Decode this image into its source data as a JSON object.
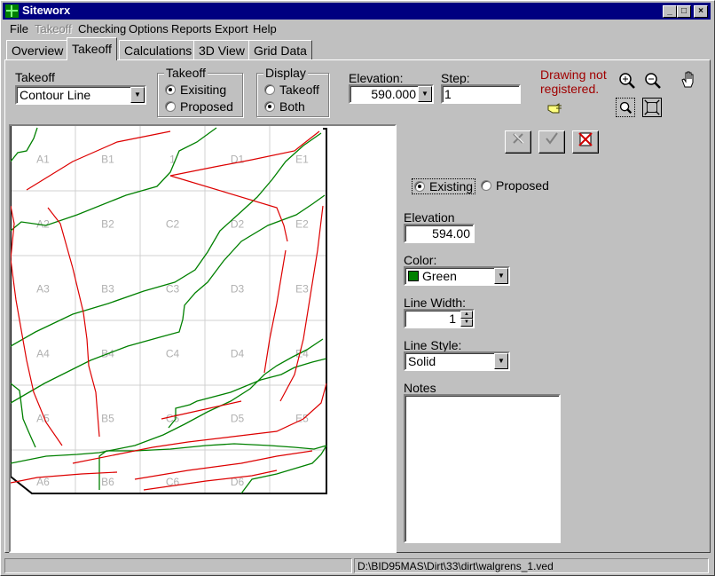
{
  "window": {
    "title": "Siteworx"
  },
  "menu": [
    "File",
    "Takeoff",
    "Checking",
    "Options",
    "Reports",
    "Export",
    "Help"
  ],
  "tabs": [
    "Overview",
    "Takeoff",
    "Calculations",
    "3D View",
    "Grid Data"
  ],
  "toolbar": {
    "takeoff_label": "Takeoff",
    "takeoff_value": "Contour Line",
    "takeoff_group_label": "Takeoff",
    "takeoff_opt_existing": "Exisiting",
    "takeoff_opt_proposed": "Proposed",
    "display_group_label": "Display",
    "display_opt_takeoff": "Takeoff",
    "display_opt_both": "Both",
    "elevation_label": "Elevation:",
    "elevation_value": "590.000",
    "step_label": "Step:",
    "step_value": "1",
    "warning": "Drawing not registered."
  },
  "grid": {
    "labels": [
      [
        "A1",
        "B1",
        "1",
        "D1",
        "E1"
      ],
      [
        "A2",
        "B2",
        "C2",
        "D2",
        "E2"
      ],
      [
        "A3",
        "B3",
        "C3",
        "D3",
        "E3"
      ],
      [
        "A4",
        "B4",
        "C4",
        "D4",
        "E4"
      ],
      [
        "A5",
        "B5",
        "C5",
        "D5",
        "E5"
      ],
      [
        "A6",
        "B6",
        "C6",
        "D6",
        ""
      ]
    ]
  },
  "properties": {
    "type_existing": "Existing",
    "type_proposed": "Proposed",
    "elevation_label": "Elevation",
    "elevation_value": "594.00",
    "color_label": "Color:",
    "color_value": "Green",
    "color_swatch": "#008000",
    "line_width_label": "Line Width:",
    "line_width_value": "1",
    "line_style_label": "Line Style:",
    "line_style_value": "Solid",
    "notes_label": "Notes"
  },
  "status": {
    "path": "D:\\BID95MAS\\Dirt\\33\\dirt\\walgrens_1.ved"
  },
  "colors": {
    "existing_contour": "#008000",
    "proposed_contour": "#dd0000",
    "titlebar": "#000080"
  }
}
